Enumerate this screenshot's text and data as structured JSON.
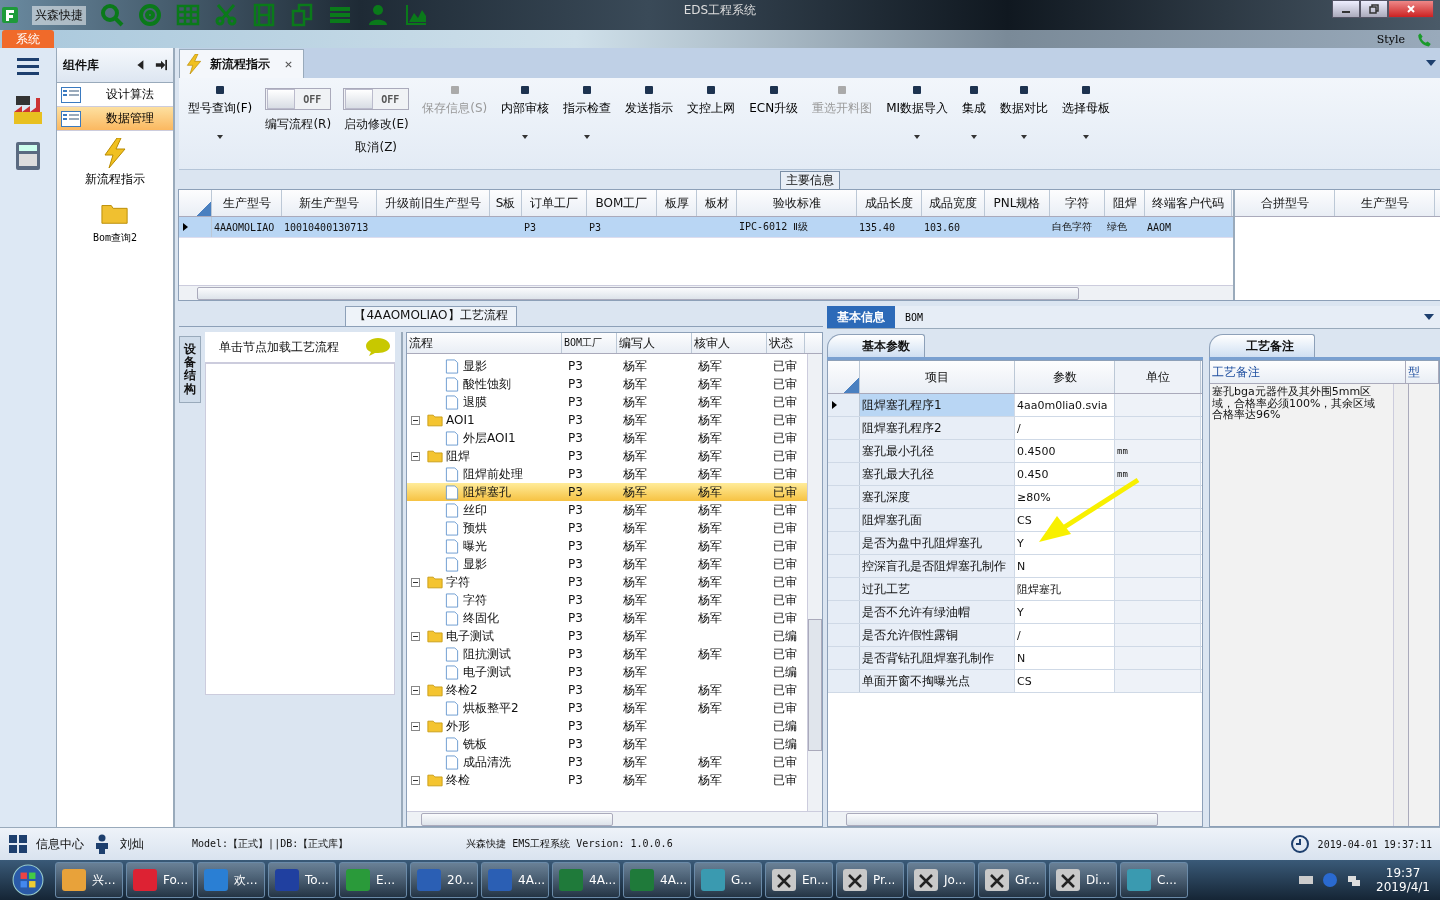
{
  "window": {
    "title": "EDS工程系统",
    "quick_access_label": "兴森快捷",
    "style_label": "Style"
  },
  "ribbon_tab": {
    "label": "系统"
  },
  "component_panel": {
    "title": "组件库",
    "items": [
      {
        "label": "设计算法",
        "selected": false
      },
      {
        "label": "数据管理",
        "selected": true
      }
    ],
    "tools": [
      {
        "label": "新流程指示"
      },
      {
        "label": "Bom查询2"
      }
    ]
  },
  "doc_tab": {
    "label": "新流程指示"
  },
  "toolbar": [
    {
      "kind": "button",
      "label": "型号查询(F)",
      "disabled": false,
      "dropdown": true
    },
    {
      "kind": "toggle",
      "label": "编写流程(R)",
      "state_text": "OFF",
      "on": false
    },
    {
      "kind": "toggle",
      "label": "启动修改(E)",
      "sublabel": "取消(Z)",
      "state_text": "OFF",
      "on": false
    },
    {
      "kind": "button",
      "label": "保存信息(S)",
      "disabled": true,
      "dropdown": false
    },
    {
      "kind": "button",
      "label": "内部审核",
      "disabled": false,
      "dropdown": true
    },
    {
      "kind": "button",
      "label": "指示检查",
      "disabled": false,
      "dropdown": true
    },
    {
      "kind": "button",
      "label": "发送指示",
      "disabled": false,
      "dropdown": false
    },
    {
      "kind": "button",
      "label": "文控上网",
      "disabled": false,
      "dropdown": false
    },
    {
      "kind": "button",
      "label": "ECN升级",
      "disabled": false,
      "dropdown": false
    },
    {
      "kind": "button",
      "label": "重选开料图",
      "disabled": true,
      "dropdown": false
    },
    {
      "kind": "button",
      "label": "MI数据导入",
      "disabled": false,
      "dropdown": true
    },
    {
      "kind": "button",
      "label": "集成",
      "disabled": false,
      "dropdown": true
    },
    {
      "kind": "button",
      "label": "数据对比",
      "disabled": false,
      "dropdown": true
    },
    {
      "kind": "button",
      "label": "选择母板",
      "disabled": false,
      "dropdown": true
    }
  ],
  "main_info": {
    "title": "主要信息",
    "columns": [
      "生产型号",
      "新生产型号",
      "升级前旧生产型号",
      "S板",
      "订单工厂",
      "BOM工厂",
      "板厚",
      "板材",
      "验收标准",
      "成品长度",
      "成品宽度",
      "PNL规格",
      "字符",
      "阻焊",
      "终端客户代码"
    ],
    "rows": [
      {
        "selected": true,
        "cells": [
          "4AAOMOLIAO",
          "10010400130713",
          "",
          "",
          "P3",
          "P3",
          "",
          "",
          "IPC-6012 Ⅱ级",
          "135.40",
          "103.60",
          "",
          "白色字符",
          "绿色",
          "AAOM"
        ]
      }
    ],
    "side_columns": [
      "合拼型号",
      "生产型号"
    ]
  },
  "process": {
    "title": "【4AAOMOLIAO】工艺流程",
    "side_tab": "设备结构",
    "hint": "单击节点加载工艺流程",
    "columns": [
      "流程",
      "BOM工厂",
      "编写人",
      "核审人",
      "状态"
    ],
    "tree": [
      {
        "children": [
          {
            "kind": "file",
            "label": "显影",
            "bom": "P3",
            "author": "杨军",
            "reviewer": "杨军",
            "status": "已审",
            "selected": false
          },
          {
            "kind": "file",
            "label": "酸性蚀刻",
            "bom": "P3",
            "author": "杨军",
            "reviewer": "杨军",
            "status": "已审",
            "selected": false
          },
          {
            "kind": "file",
            "label": "退膜",
            "bom": "P3",
            "author": "杨军",
            "reviewer": "杨军",
            "status": "已审",
            "selected": false
          }
        ]
      },
      {
        "kind": "folder",
        "label": "AOI1",
        "bom": "P3",
        "author": "杨军",
        "reviewer": "杨军",
        "status": "已审",
        "selected": false,
        "expanded": true,
        "children": [
          {
            "kind": "file",
            "label": "外层AOI1",
            "bom": "P3",
            "author": "杨军",
            "reviewer": "杨军",
            "status": "已审",
            "selected": false
          }
        ]
      },
      {
        "kind": "folder",
        "label": "阻焊",
        "bom": "P3",
        "author": "杨军",
        "reviewer": "杨军",
        "status": "已审",
        "selected": false,
        "expanded": true,
        "children": [
          {
            "kind": "file",
            "label": "阻焊前处理",
            "bom": "P3",
            "author": "杨军",
            "reviewer": "杨军",
            "status": "已审",
            "selected": false
          },
          {
            "kind": "file",
            "label": "阻焊塞孔",
            "bom": "P3",
            "author": "杨军",
            "reviewer": "杨军",
            "status": "已审",
            "selected": true
          },
          {
            "kind": "file",
            "label": "丝印",
            "bom": "P3",
            "author": "杨军",
            "reviewer": "杨军",
            "status": "已审",
            "selected": false
          },
          {
            "kind": "file",
            "label": "预烘",
            "bom": "P3",
            "author": "杨军",
            "reviewer": "杨军",
            "status": "已审",
            "selected": false
          },
          {
            "kind": "file",
            "label": "曝光",
            "bom": "P3",
            "author": "杨军",
            "reviewer": "杨军",
            "status": "已审",
            "selected": false
          },
          {
            "kind": "file",
            "label": "显影",
            "bom": "P3",
            "author": "杨军",
            "reviewer": "杨军",
            "status": "已审",
            "selected": false
          }
        ]
      },
      {
        "kind": "folder",
        "label": "字符",
        "bom": "P3",
        "author": "杨军",
        "reviewer": "杨军",
        "status": "已审",
        "selected": false,
        "expanded": true,
        "children": [
          {
            "kind": "file",
            "label": "字符",
            "bom": "P3",
            "author": "杨军",
            "reviewer": "杨军",
            "status": "已审",
            "selected": false
          },
          {
            "kind": "file",
            "label": "终固化",
            "bom": "P3",
            "author": "杨军",
            "reviewer": "杨军",
            "status": "已审",
            "selected": false
          }
        ]
      },
      {
        "kind": "folder",
        "label": "电子测试",
        "bom": "P3",
        "author": "杨军",
        "status": "已编",
        "selected": false,
        "expanded": true,
        "children": [
          {
            "kind": "file",
            "label": "阻抗测试",
            "bom": "P3",
            "author": "杨军",
            "reviewer": "杨军",
            "status": "已审",
            "selected": false
          },
          {
            "kind": "file",
            "label": "电子测试",
            "bom": "P3",
            "author": "杨军",
            "status": "已编",
            "selected": false
          }
        ]
      },
      {
        "kind": "folder",
        "label": "终检2",
        "bom": "P3",
        "author": "杨军",
        "reviewer": "杨军",
        "status": "已审",
        "selected": false,
        "expanded": true,
        "children": [
          {
            "kind": "file",
            "label": "烘板整平2",
            "bom": "P3",
            "author": "杨军",
            "reviewer": "杨军",
            "status": "已审",
            "selected": false
          }
        ]
      },
      {
        "kind": "folder",
        "label": "外形",
        "bom": "P3",
        "author": "杨军",
        "status": "已编",
        "selected": false,
        "expanded": true,
        "children": [
          {
            "kind": "file",
            "label": "铣板",
            "bom": "P3",
            "author": "杨军",
            "status": "已编",
            "selected": false
          },
          {
            "kind": "file",
            "label": "成品清洗",
            "bom": "P3",
            "author": "杨军",
            "reviewer": "杨军",
            "status": "已审",
            "selected": false
          }
        ]
      },
      {
        "kind": "folder",
        "label": "终检",
        "bom": "P3",
        "author": "杨军",
        "reviewer": "杨军",
        "status": "已审",
        "selected": false,
        "expanded": true
      }
    ]
  },
  "details": {
    "tabs": [
      {
        "label": "基本信息",
        "selected": true
      },
      {
        "label": "BOM",
        "selected": false
      }
    ],
    "params": {
      "tab": "基本参数",
      "columns": [
        "项目",
        "参数",
        "单位"
      ],
      "rows": [
        {
          "item": "阻焊塞孔程序1",
          "value": "4aa0m0lia0.svia",
          "unit": "",
          "selected": true
        },
        {
          "item": "阻焊塞孔程序2",
          "value": "/",
          "unit": "",
          "selected": false
        },
        {
          "item": "塞孔最小孔径",
          "value": "0.4500",
          "unit": "mm",
          "selected": false
        },
        {
          "item": "塞孔最大孔径",
          "value": "0.450",
          "unit": "mm",
          "selected": false
        },
        {
          "item": "塞孔深度",
          "value": "≥80%",
          "unit": "",
          "selected": false
        },
        {
          "item": "阻焊塞孔面",
          "value": "CS",
          "unit": "",
          "selected": false
        },
        {
          "item": "是否为盘中孔阻焊塞孔",
          "value": "Y",
          "unit": "",
          "selected": false
        },
        {
          "item": "控深盲孔是否阻焊塞孔制作",
          "value": "N",
          "unit": "",
          "selected": false
        },
        {
          "item": "过孔工艺",
          "value": "阻焊塞孔",
          "unit": "",
          "selected": false
        },
        {
          "item": "是否不允许有绿油帽",
          "value": "Y",
          "unit": "",
          "selected": false
        },
        {
          "item": "是否允许假性露铜",
          "value": "/",
          "unit": "",
          "selected": false
        },
        {
          "item": "是否背钻孔阻焊塞孔制作",
          "value": "N",
          "unit": "",
          "selected": false
        },
        {
          "item": "单面开窗不掏曝光点",
          "value": "CS",
          "unit": "",
          "selected": false
        }
      ]
    },
    "notes": {
      "tab": "工艺备注",
      "columns": [
        "工艺备注",
        "型"
      ],
      "text": "塞孔bga元器件及其外围5mm区域，合格率必须100%，其余区域合格率达96%"
    }
  },
  "status_bar": {
    "info_center": "信息中心",
    "user": "刘灿",
    "env": "Model:【正式】||DB:【正式库】",
    "version": "兴森快捷 EMS工程系统 Version: 1.0.0.6",
    "datetime": "2019-04-01 19:37:11"
  },
  "taskbar": {
    "items": [
      {
        "kind": "shell",
        "label": "兴..."
      },
      {
        "kind": "red",
        "label": "Fo..."
      },
      {
        "kind": "ie",
        "label": "欢..."
      },
      {
        "kind": "disk",
        "label": "To..."
      },
      {
        "kind": "app",
        "label": "E..."
      },
      {
        "kind": "word",
        "label": "20..."
      },
      {
        "kind": "word",
        "label": "4A..."
      },
      {
        "kind": "excel",
        "label": "4A..."
      },
      {
        "kind": "excel",
        "label": "4A..."
      },
      {
        "kind": "tool",
        "label": "G..."
      },
      {
        "kind": "xwin",
        "label": "En..."
      },
      {
        "kind": "xwin",
        "label": "Pr..."
      },
      {
        "kind": "xwin",
        "label": "Jo..."
      },
      {
        "kind": "xwin",
        "label": "Gr..."
      },
      {
        "kind": "xwin",
        "label": "Di..."
      },
      {
        "kind": "tool",
        "label": "C..."
      }
    ],
    "time": "19:37",
    "date": "2019/4/1"
  }
}
